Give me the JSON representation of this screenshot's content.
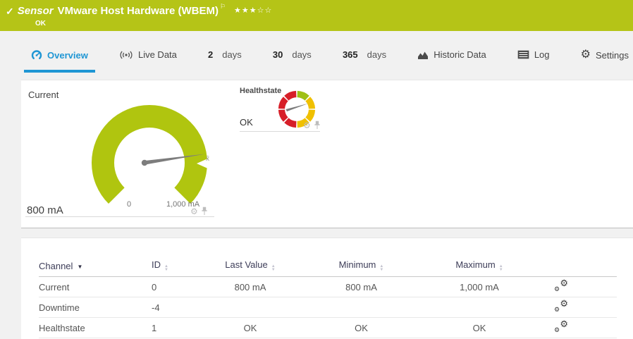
{
  "colors": {
    "brand_green": "#b5c417",
    "gauge_green": "#b0c50f",
    "accent_blue": "#1f96d4",
    "status_ok_green": "#9fc015",
    "status_warning_yellow": "#f0c000",
    "status_error_red": "#d71e28"
  },
  "icons": {
    "check": "✓",
    "flag": "⚐",
    "gear": "⚙",
    "sort_up": "▲",
    "sort_down": "▼",
    "sort_desc": "▼",
    "stars": "★★★☆☆"
  },
  "header": {
    "kind_label": "Sensor",
    "title": "VMware Host Hardware (WBEM)",
    "status": "OK",
    "priority_filled": 3,
    "priority_total": 5
  },
  "tabs": [
    {
      "label": "Overview",
      "icon": "gauge-icon",
      "active": true
    },
    {
      "label": "Live Data",
      "icon": "broadcast-icon",
      "active": false
    },
    {
      "strong": "2",
      "label": "days",
      "active": false
    },
    {
      "strong": "30",
      "label": "days",
      "active": false
    },
    {
      "strong": "365",
      "label": "days",
      "active": false
    },
    {
      "label": "Historic Data",
      "icon": "area-chart-icon",
      "active": false
    },
    {
      "label": "Log",
      "icon": "log-icon",
      "active": false
    },
    {
      "label": "Settings",
      "icon": "gear-icon",
      "active": false
    }
  ],
  "gauges": {
    "current": {
      "title": "Current",
      "value": "800 mA",
      "scale_min": "0",
      "scale_max": "1,000 mA",
      "average_marker": "x̄"
    },
    "healthstate": {
      "title": "Healthstate",
      "value": "OK"
    }
  },
  "table": {
    "columns": [
      {
        "label": "Channel",
        "sort": "desc"
      },
      {
        "label": "ID",
        "sort": "none"
      },
      {
        "label": "Last Value",
        "sort": "none"
      },
      {
        "label": "Minimum",
        "sort": "none"
      },
      {
        "label": "Maximum",
        "sort": "none"
      }
    ],
    "rows": [
      {
        "channel": "Current",
        "id": "0",
        "last_value": "800 mA",
        "minimum": "800 mA",
        "maximum": "1,000 mA"
      },
      {
        "channel": "Downtime",
        "id": "-4",
        "last_value": "",
        "minimum": "",
        "maximum": ""
      },
      {
        "channel": "Healthstate",
        "id": "1",
        "last_value": "OK",
        "minimum": "OK",
        "maximum": "OK"
      }
    ]
  }
}
